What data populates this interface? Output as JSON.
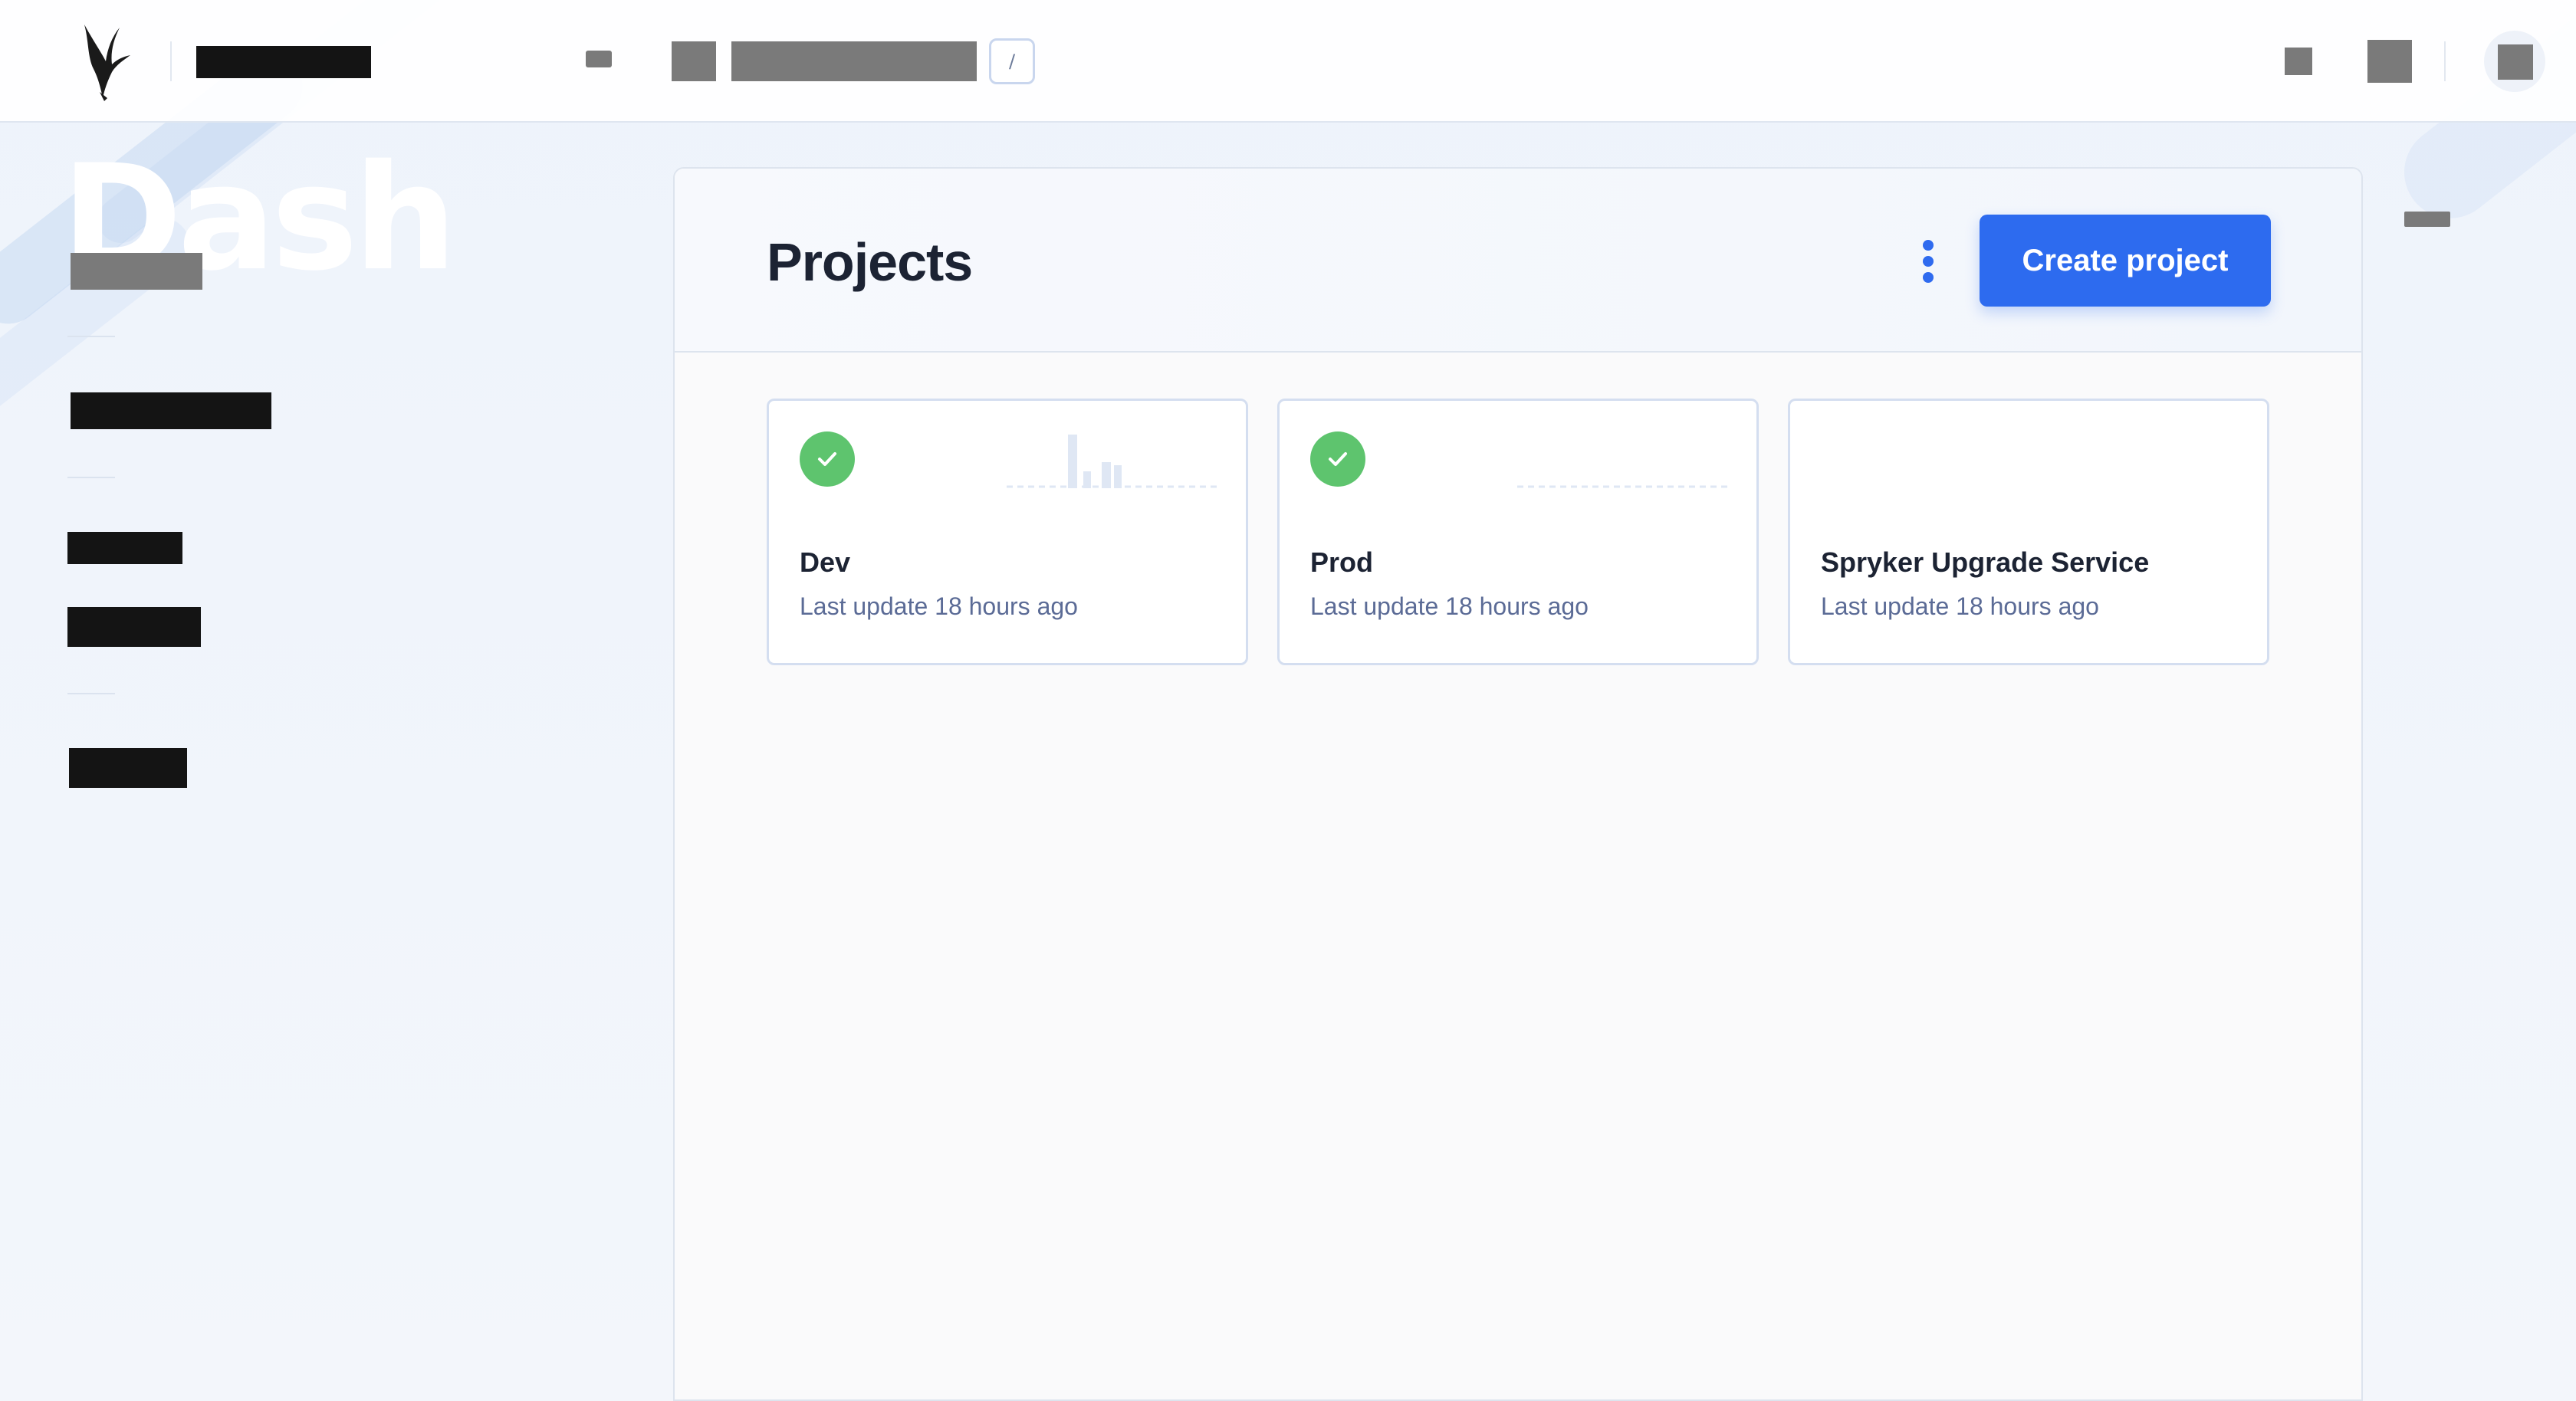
{
  "header": {
    "search_shortcut": "/"
  },
  "sidebar": {
    "watermark": "Dash"
  },
  "main": {
    "title": "Projects",
    "create_button_label": "Create project",
    "projects": [
      {
        "name": "Dev",
        "updated": "Last update 18 hours ago",
        "status": "ok",
        "status_icon": "check-icon"
      },
      {
        "name": "Prod",
        "updated": "Last update 18 hours ago",
        "status": "ok",
        "status_icon": "check-icon"
      },
      {
        "name": "Spryker Upgrade Service",
        "updated": "Last update 18 hours ago",
        "status": "none"
      }
    ]
  },
  "colors": {
    "accent": "#2d6bef",
    "success": "#5ec46e",
    "text": "#1c2333",
    "muted": "#5b6b96"
  }
}
